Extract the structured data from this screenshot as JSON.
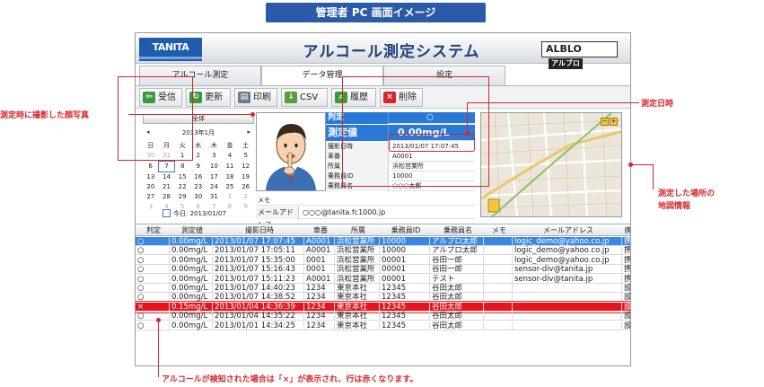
{
  "banner": "管理者 PC 画面イメージ",
  "app": {
    "logo": "TANITA",
    "title": "アルコール測定システム",
    "brand": "ALBLO",
    "brand_sub": "アルブロ"
  },
  "tabs": [
    {
      "label": "アルコール測定"
    },
    {
      "label": "データ管理"
    },
    {
      "label": "設定"
    }
  ],
  "toolbar": [
    {
      "label": "受信",
      "icon": "receive-icon",
      "color": "#3c9a3c"
    },
    {
      "label": "更新",
      "icon": "refresh-icon",
      "color": "#3c9a3c"
    },
    {
      "label": "印刷",
      "icon": "print-icon",
      "color": "#6d7b8c"
    },
    {
      "label": "CSV",
      "icon": "csv-icon",
      "color": "#5b9b3a"
    },
    {
      "label": "履歴",
      "icon": "history-icon",
      "color": "#3c9a3c"
    },
    {
      "label": "削除",
      "icon": "delete-icon",
      "color": "#d7262b"
    }
  ],
  "calendar": {
    "all_button": "全体",
    "month": "2013年1月",
    "prev": "◂",
    "next": "▸",
    "weekdays": [
      "日",
      "月",
      "火",
      "水",
      "木",
      "金",
      "土"
    ],
    "weeks": [
      [
        "30",
        "31",
        "1",
        "2",
        "3",
        "4",
        "5"
      ],
      [
        "6",
        "7",
        "8",
        "9",
        "10",
        "11",
        "12"
      ],
      [
        "13",
        "14",
        "15",
        "16",
        "17",
        "18",
        "19"
      ],
      [
        "20",
        "21",
        "22",
        "23",
        "24",
        "25",
        "26"
      ],
      [
        "27",
        "28",
        "29",
        "30",
        "31",
        "1",
        "2"
      ],
      [
        "3",
        "4",
        "5",
        "6",
        "7",
        "8",
        "9"
      ]
    ],
    "today": "今日: 2013/01/07"
  },
  "detail": {
    "judge_label": "判定",
    "judge_value": "○",
    "measure_label": "測定値",
    "measure_value": "0.00mg/L",
    "rows": [
      {
        "k": "撮影日時",
        "v": "2013/01/07 17:07:45"
      },
      {
        "k": "車番",
        "v": "A0001"
      },
      {
        "k": "所属",
        "v": "浜松営業所"
      },
      {
        "k": "乗務員ID",
        "v": "10000"
      },
      {
        "k": "乗務員名",
        "v": "○○○太郎"
      }
    ],
    "memo_label": "メモ",
    "mail_label": "メールアドレス",
    "mail_value": "○○○@tanita.fc1000.jp"
  },
  "grid": {
    "headers": [
      "判定",
      "測定値",
      "撮影日時",
      "車番",
      "所属",
      "乗務員ID",
      "乗務員名",
      "メモ",
      "メールアドレス",
      "携"
    ],
    "rows": [
      {
        "state": "sel",
        "cells": [
          "○",
          "0.00mg/L",
          "2013/01/07 17:07:45",
          "A0001",
          "浜松営業所",
          "10000",
          "アルプロ太郎",
          "",
          "logic_demo@yahoo.co.jp",
          "携"
        ]
      },
      {
        "state": "",
        "cells": [
          "○",
          "0.00mg/L",
          "2013/01/07 17:05:11",
          "A0001",
          "浜松営業所",
          "10000",
          "アルプロ太郎",
          "",
          "logic_demo@yahoo.co.jp",
          "携"
        ]
      },
      {
        "state": "",
        "cells": [
          "○",
          "0.00mg/L",
          "2013/01/07 15:35:00",
          "0001",
          "浜松営業所",
          "00001",
          "谷田一郎",
          "",
          "logic_demo@yahoo.co.jp",
          "携"
        ]
      },
      {
        "state": "",
        "cells": [
          "○",
          "0.00mg/L",
          "2013/01/07 15:16:43",
          "0001",
          "浜松営業所",
          "00001",
          "谷田一郎",
          "",
          "sensor-div@tanita.jp",
          "携"
        ]
      },
      {
        "state": "",
        "cells": [
          "○",
          "0.00mg/L",
          "2013/01/07 15:11:23",
          "A0001",
          "浜松営業所",
          "00001",
          "テスト",
          "",
          "sensor-div@tanita.jp",
          "携"
        ]
      },
      {
        "state": "",
        "cells": [
          "○",
          "0.00mg/L",
          "2013/01/07 14:40:23",
          "1234",
          "東京本社",
          "12345",
          "谷田太郎",
          "",
          "",
          "設"
        ]
      },
      {
        "state": "",
        "cells": [
          "○",
          "0.00mg/L",
          "2013/01/07 14:38:52",
          "1234",
          "東京本社",
          "12345",
          "谷田太郎",
          "",
          "",
          "設"
        ]
      },
      {
        "state": "alert",
        "cells": [
          "×",
          "0.15mg/L",
          "2013/01/04 14:36:39",
          "1234",
          "東京本社",
          "12345",
          "谷田太郎",
          "",
          "",
          "設"
        ]
      },
      {
        "state": "",
        "cells": [
          "○",
          "0.00mg/L",
          "2013/01/04 14:35:22",
          "1234",
          "東京本社",
          "12345",
          "谷田太郎",
          "",
          "",
          "設"
        ]
      },
      {
        "state": "",
        "cells": [
          "○",
          "0.00mg/L",
          "2013/01/01 14:34:25",
          "1234",
          "東京本社",
          "12345",
          "谷田太郎",
          "",
          "",
          "設"
        ]
      }
    ]
  },
  "callouts": {
    "photo": "測定時に撮影した顔写真",
    "datetime": "測定日時",
    "map_line1": "測定した場所の",
    "map_line2": "地図情報",
    "alert": "アルコールが検知された場合は「×」が表示され、行は赤くなります。"
  },
  "colors": {
    "accent": "#2a79d6",
    "alert": "#e8141c",
    "callout": "#d7262b"
  }
}
